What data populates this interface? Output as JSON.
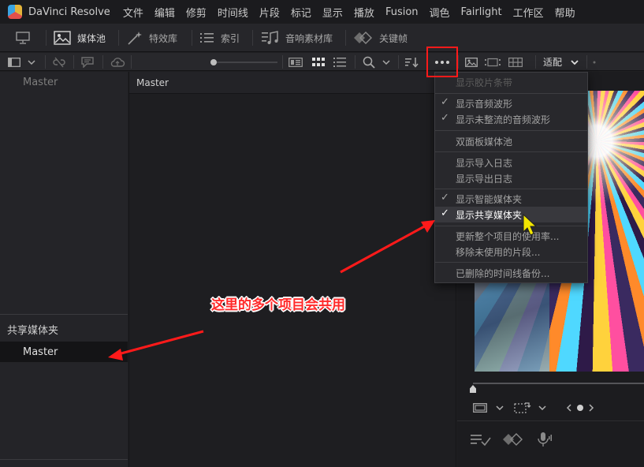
{
  "app": {
    "title": "DaVinci Resolve",
    "menu": [
      "文件",
      "编辑",
      "修剪",
      "时间线",
      "片段",
      "标记",
      "显示",
      "播放",
      "Fusion",
      "调色",
      "Fairlight",
      "工作区",
      "帮助"
    ]
  },
  "toolbar": {
    "media_pool": "媒体池",
    "effects": "特效库",
    "index": "索引",
    "sound_library": "音响素材库",
    "keyframes": "关键帧"
  },
  "bar2": {
    "fit_label": "适配"
  },
  "left": {
    "master_bin": "Master",
    "shared_bins_title": "共享媒体夹",
    "shared_master": "Master"
  },
  "center": {
    "header": "Master"
  },
  "dropdown": {
    "items": [
      {
        "label": "显示胶片条带",
        "checked": false,
        "enabled": false
      },
      {
        "label": "显示音频波形",
        "checked": true,
        "enabled": true
      },
      {
        "label": "显示未整流的音频波形",
        "checked": true,
        "enabled": true
      },
      {
        "label": "双面板媒体池",
        "checked": false,
        "enabled": true
      },
      {
        "label": "显示导入日志",
        "checked": false,
        "enabled": true
      },
      {
        "label": "显示导出日志",
        "checked": false,
        "enabled": true
      },
      {
        "label": "显示智能媒体夹",
        "checked": true,
        "enabled": true
      },
      {
        "label": "显示共享媒体夹",
        "checked": true,
        "enabled": true,
        "highlighted": true
      },
      {
        "label": "更新整个项目的使用率...",
        "checked": false,
        "enabled": true
      },
      {
        "label": "移除未使用的片段...",
        "checked": false,
        "enabled": true
      },
      {
        "label": "已删除的时间线备份...",
        "checked": false,
        "enabled": true
      }
    ],
    "check_glyph": "✓"
  },
  "annotation": {
    "text": "这里的多个项目会共用",
    "color": "#ff1a1a"
  },
  "colors": {
    "accent_red": "#ff1a1a",
    "cursor_yellow": "#f2e600"
  }
}
